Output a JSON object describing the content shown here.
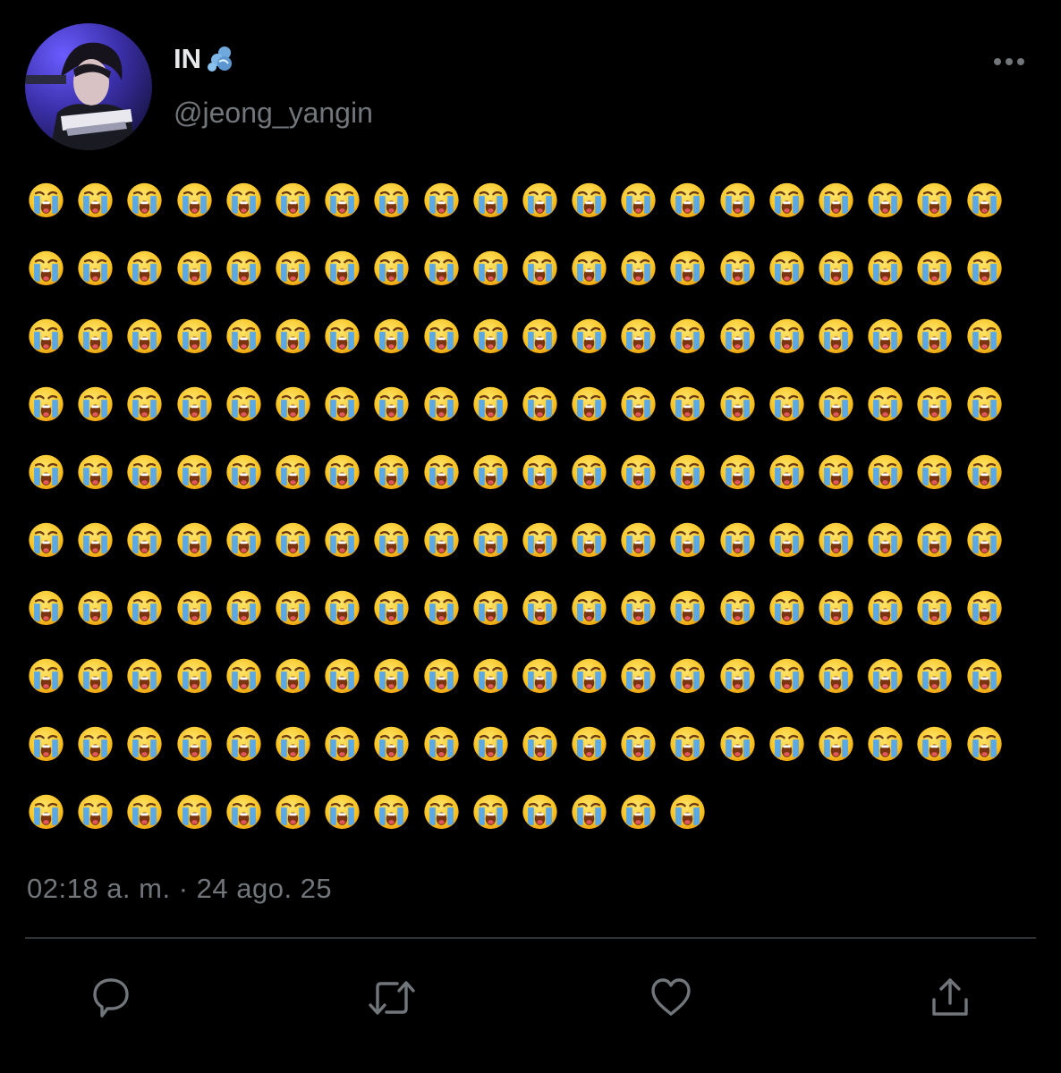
{
  "tweet": {
    "author": {
      "display_name": "IN",
      "name_emoji_icon": "dashing-away-icon",
      "handle": "@jeong_yangin"
    },
    "body": {
      "emoji": "loudly-crying-face",
      "emoji_count": 194,
      "emoji_per_line": 20
    },
    "timestamp": "02:18 a. m. · 24 ago. 25",
    "actions": [
      {
        "name": "reply",
        "icon": "speech-bubble-icon"
      },
      {
        "name": "retweet",
        "icon": "retweet-arrows-icon"
      },
      {
        "name": "like",
        "icon": "heart-outline-icon"
      },
      {
        "name": "share",
        "icon": "share-upload-icon"
      }
    ]
  },
  "colors": {
    "background": "#000000",
    "text_primary": "#e7e9ea",
    "text_secondary": "#71767b",
    "divider": "#2f3336",
    "icon": "#71767b"
  }
}
